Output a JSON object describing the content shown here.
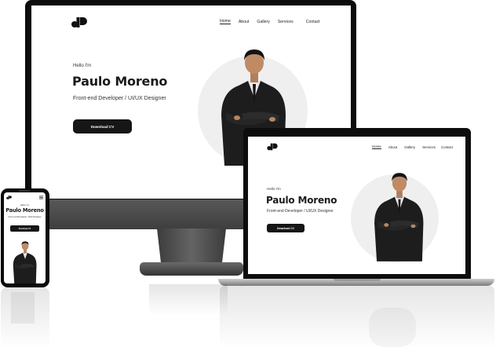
{
  "site": {
    "nav": [
      "Home",
      "About",
      "Gallery",
      "Services",
      "Contact"
    ],
    "greeting": "Hello I'm",
    "name": "Paulo Moreno",
    "role_desktop": "Front-end Developer / UI/UX Designer",
    "role_laptop": "Front-end Developer / UI/UX Designer",
    "role_phone": "Front-end Developer / Web Designer",
    "cta": "Download CV"
  },
  "colors": {
    "ink": "#161616",
    "blob": "#efefef",
    "page": "#ffffff"
  },
  "icons": [
    "monogram-logo-icon",
    "hamburger-menu-icon"
  ]
}
